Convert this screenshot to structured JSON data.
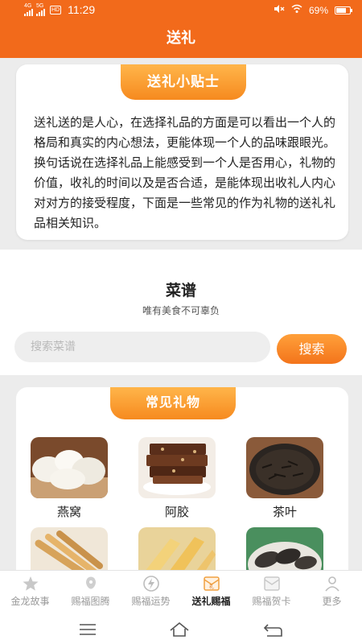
{
  "status_bar": {
    "net1": "4G",
    "net2": "5G",
    "hd": "HD",
    "time": "11:29",
    "battery": "69%"
  },
  "header": {
    "title": "送礼"
  },
  "tips": {
    "banner": "送礼小贴士",
    "text": "送礼送的是人心，在选择礼品的方面是可以看出一个人的格局和真实的内心想法，更能体现一个人的品味跟眼光。换句话说在选择礼品上能感受到一个人是否用心，礼物的价值，收礼的时间以及是否合适，是能体现出收礼人内心对对方的接受程度，下面是一些常见的作为礼物的送礼礼品相关知识。"
  },
  "recipe": {
    "title": "菜谱",
    "subtitle": "唯有美食不可辜负",
    "search_placeholder": "搜索菜谱",
    "search_button": "搜索"
  },
  "gifts": {
    "banner": "常见礼物",
    "items": [
      {
        "name": "燕窝",
        "icon": "birds-nest-image"
      },
      {
        "name": "阿胶",
        "icon": "ejiao-image"
      },
      {
        "name": "茶叶",
        "icon": "tea-leaves-image"
      },
      {
        "name": "",
        "icon": "ginseng-image"
      },
      {
        "name": "",
        "icon": "fish-maw-image"
      },
      {
        "name": "",
        "icon": "sea-cucumber-image"
      }
    ]
  },
  "nav": {
    "items": [
      {
        "label": "金龙故事",
        "icon": "star-icon"
      },
      {
        "label": "赐福图腾",
        "icon": "totem-icon"
      },
      {
        "label": "赐福运势",
        "icon": "lightning-icon"
      },
      {
        "label": "送礼赐福",
        "icon": "gift-envelope-icon"
      },
      {
        "label": "赐福贺卡",
        "icon": "card-envelope-icon"
      },
      {
        "label": "更多",
        "icon": "person-icon"
      }
    ],
    "active_index": 3
  },
  "colors": {
    "primary": "#f26a1b",
    "banner": "#f68a1f",
    "background": "#ececec"
  }
}
